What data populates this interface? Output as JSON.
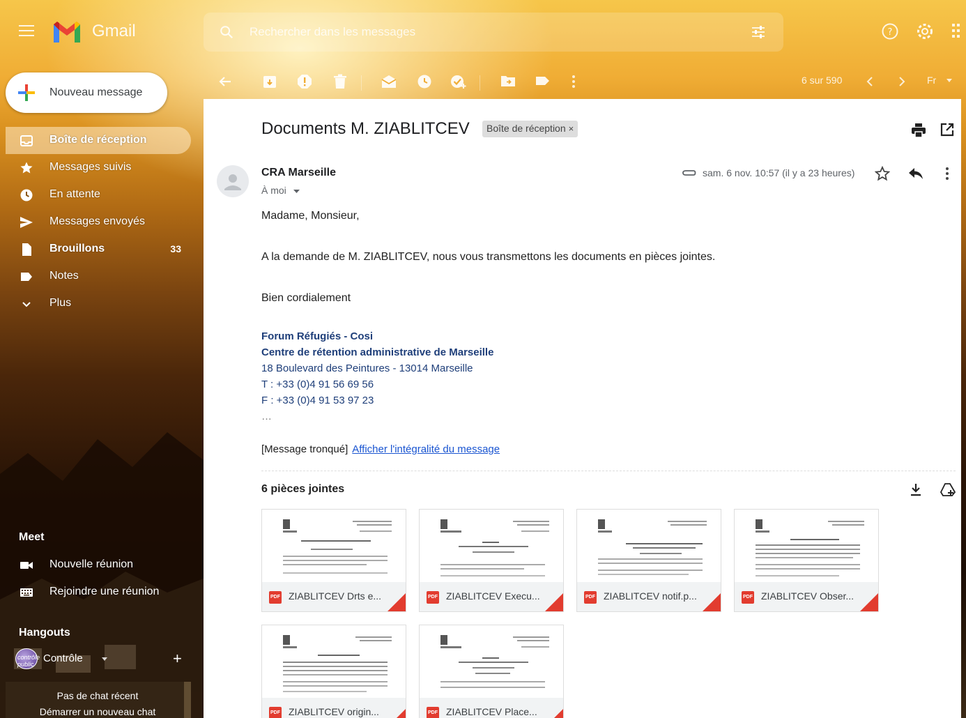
{
  "app": {
    "name": "Gmail"
  },
  "search": {
    "placeholder": "Rechercher dans les messages"
  },
  "compose": {
    "label": "Nouveau message"
  },
  "sidebar": {
    "items": [
      {
        "label": "Boîte de réception",
        "count": ""
      },
      {
        "label": "Messages suivis",
        "count": ""
      },
      {
        "label": "En attente",
        "count": ""
      },
      {
        "label": "Messages envoyés",
        "count": ""
      },
      {
        "label": "Brouillons",
        "count": "33"
      },
      {
        "label": "Notes",
        "count": ""
      },
      {
        "label": "Plus",
        "count": ""
      }
    ],
    "meet": {
      "title": "Meet",
      "items": [
        {
          "label": "Nouvelle réunion"
        },
        {
          "label": "Rejoindre une réunion"
        }
      ]
    },
    "hangouts": {
      "title": "Hangouts",
      "user": "Contrôle",
      "avatar_text": "contrôle public",
      "no_chat": "Pas de chat récent",
      "start_chat": "Démarrer un nouveau chat"
    }
  },
  "toolbar": {
    "pager": "6 sur 590",
    "lang": "Fr"
  },
  "message": {
    "subject": "Documents M. ZIABLITCEV",
    "label": "Boîte de réception",
    "label_close": "×",
    "sender": "CRA Marseille",
    "to": "À moi",
    "date": "sam. 6 nov. 10:57 (il y a 23 heures)",
    "body": {
      "greeting": "Madame, Monsieur,",
      "line1": "A la demande de M. ZIABLITCEV, nous vous transmettons les documents en pièces jointes.",
      "closing": "Bien cordialement"
    },
    "signature": {
      "org": "Forum Réfugiés - Cosi",
      "center": "Centre de rétention administrative de Marseille",
      "address": "18 Boulevard des Peintures - 13014 Marseille",
      "tel": "T : +33 (0)4 91 56 69 56",
      "fax": "F : +33 (0)4 91 53 97 23",
      "ellipsis": "…"
    },
    "truncated": {
      "text": "[Message tronqué]",
      "link": "Afficher l'intégralité du message"
    },
    "attachments": {
      "title": "6 pièces jointes",
      "files": [
        {
          "name": "ZIABLITCEV Drts e..."
        },
        {
          "name": "ZIABLITCEV Execu..."
        },
        {
          "name": "ZIABLITCEV notif.p..."
        },
        {
          "name": "ZIABLITCEV Obser..."
        },
        {
          "name": "ZIABLITCEV origin..."
        },
        {
          "name": "ZIABLITCEV Place..."
        }
      ],
      "badge": "PDF"
    }
  },
  "colors": {
    "accent": "#f0ad35",
    "pdf": "#e23c2f",
    "link": "#1a55d1",
    "signature": "#1f3f7a"
  }
}
